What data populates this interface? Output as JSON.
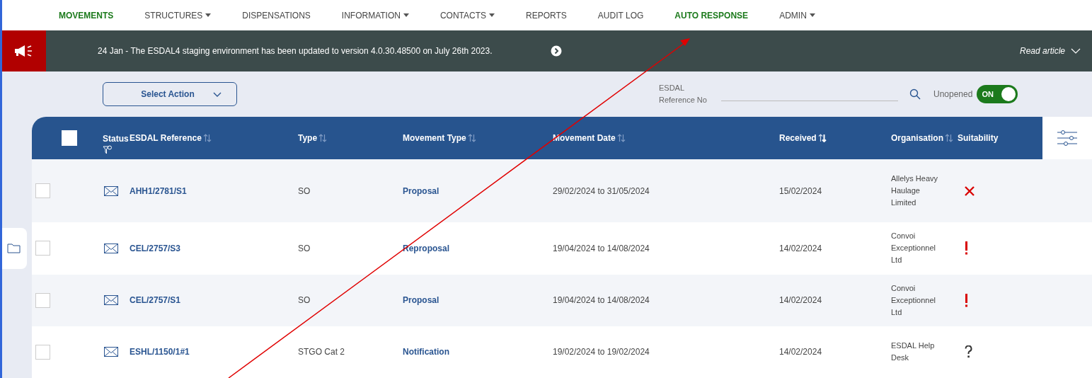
{
  "nav": [
    {
      "label": "MOVEMENTS",
      "selected": true,
      "dropdown": false
    },
    {
      "label": "STRUCTURES",
      "selected": false,
      "dropdown": true
    },
    {
      "label": "DISPENSATIONS",
      "selected": false,
      "dropdown": false
    },
    {
      "label": "INFORMATION",
      "selected": false,
      "dropdown": true
    },
    {
      "label": "CONTACTS",
      "selected": false,
      "dropdown": true
    },
    {
      "label": "REPORTS",
      "selected": false,
      "dropdown": false
    },
    {
      "label": "AUDIT LOG",
      "selected": false,
      "dropdown": false
    },
    {
      "label": "AUTO RESPONSE",
      "selected": true,
      "dropdown": false
    },
    {
      "label": "ADMIN",
      "selected": false,
      "dropdown": true
    }
  ],
  "banner": {
    "message": "24 Jan - The ESDAL4 staging environment has been updated to version 4.0.30.48500 on July 26th 2023.",
    "link": "Read article"
  },
  "toolbar": {
    "action_select": "Select Action",
    "search_label": "ESDAL Reference No",
    "unopened_label": "Unopened",
    "unopened_toggle": {
      "on": true,
      "text": "ON"
    }
  },
  "table": {
    "columns": [
      {
        "label": "Status",
        "filterable": true,
        "sortable": false
      },
      {
        "label": "ESDAL Reference",
        "filterable": false,
        "sortable": true,
        "sorted": false
      },
      {
        "label": "Type",
        "filterable": false,
        "sortable": true,
        "sorted": false
      },
      {
        "label": "Movement Type",
        "filterable": false,
        "sortable": true,
        "sorted": false
      },
      {
        "label": "Movement Date",
        "filterable": false,
        "sortable": true,
        "sorted": false
      },
      {
        "label": "Received",
        "filterable": false,
        "sortable": true,
        "sorted": true
      },
      {
        "label": "Organisation",
        "filterable": false,
        "sortable": true,
        "sorted": false
      },
      {
        "label": "Suitability",
        "filterable": false,
        "sortable": false
      }
    ],
    "header_checked": false,
    "rows": [
      {
        "checked": false,
        "reference": "AHH1/2781/S1",
        "type": "SO",
        "movement_type": "Proposal",
        "movement_date": "29/02/2024 to 31/05/2024",
        "received": "15/02/2024",
        "organisation": "Allelys Heavy Haulage Limited",
        "suitability": {
          "kind": "unsuitable"
        }
      },
      {
        "checked": false,
        "reference": "CEL/2757/S3",
        "type": "SO",
        "movement_type": "Reproposal",
        "movement_date": "19/04/2024 to 14/08/2024",
        "received": "14/02/2024",
        "organisation": "Convoi Exceptionnel Ltd",
        "suitability": {
          "kind": "warning"
        }
      },
      {
        "checked": false,
        "reference": "CEL/2757/S1",
        "type": "SO",
        "movement_type": "Proposal",
        "movement_date": "19/04/2024 to 14/08/2024",
        "received": "14/02/2024",
        "organisation": "Convoi Exceptionnel Ltd",
        "suitability": {
          "kind": "warning"
        }
      },
      {
        "checked": false,
        "reference": "ESHL/1150/1#1",
        "type": "STGO Cat 2",
        "movement_type": "Notification",
        "movement_date": "19/02/2024 to 19/02/2024",
        "received": "14/02/2024",
        "organisation": "ESDAL Help Desk",
        "suitability": {
          "kind": "unknown"
        }
      }
    ]
  }
}
